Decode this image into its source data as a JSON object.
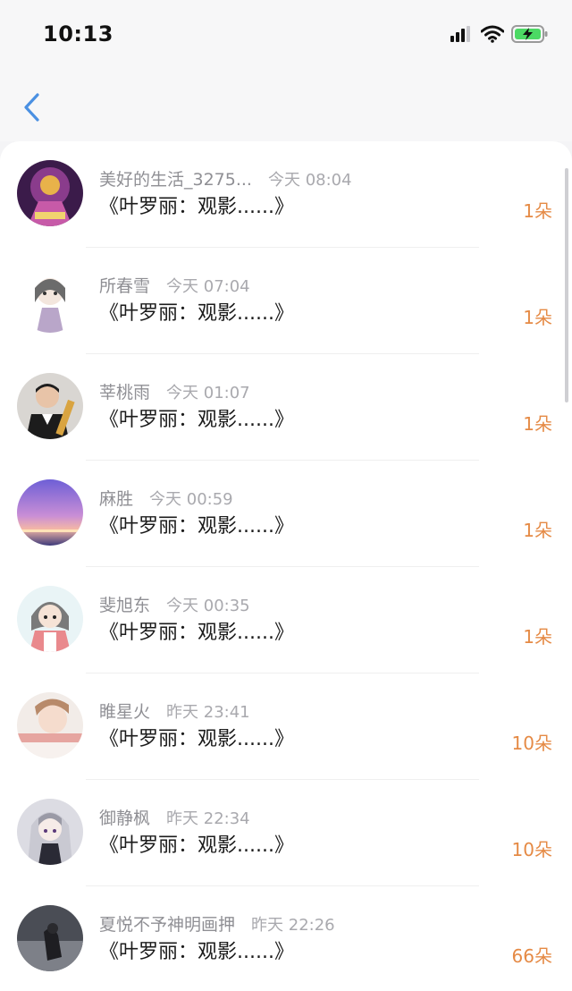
{
  "status_bar": {
    "time": "10:13"
  },
  "nav": {
    "back_icon": "chevron-left-icon",
    "accent": "#4a90e2"
  },
  "colors": {
    "count": "#e58a45",
    "name": "#8f8f94",
    "title": "#1b1b1b"
  },
  "rows": [
    {
      "name": "美好的生活_3275...",
      "time": "今天 08:04",
      "title": "《叶罗丽：观影......》",
      "count": "1朵"
    },
    {
      "name": "所春雪",
      "time": "今天 07:04",
      "title": "《叶罗丽：观影......》",
      "count": "1朵"
    },
    {
      "name": "莘桃雨",
      "time": "今天 01:07",
      "title": "《叶罗丽：观影......》",
      "count": "1朵"
    },
    {
      "name": "麻胜",
      "time": "今天 00:59",
      "title": "《叶罗丽：观影......》",
      "count": "1朵"
    },
    {
      "name": "斐旭东",
      "time": "今天 00:35",
      "title": "《叶罗丽：观影......》",
      "count": "1朵"
    },
    {
      "name": "睢星火",
      "time": "昨天 23:41",
      "title": "《叶罗丽：观影......》",
      "count": "10朵"
    },
    {
      "name": "御静枫",
      "time": "昨天 22:34",
      "title": "《叶罗丽：观影......》",
      "count": "10朵"
    },
    {
      "name": "夏悦不予神明画押",
      "time": "昨天 22:26",
      "title": "《叶罗丽：观影......》",
      "count": "66朵"
    }
  ]
}
